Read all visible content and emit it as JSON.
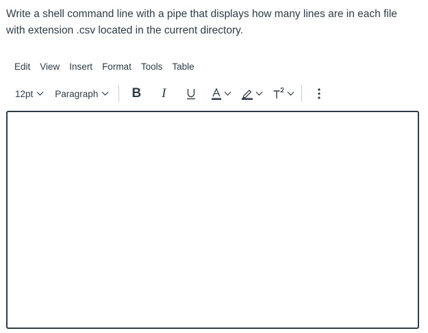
{
  "question": {
    "text": "Write a shell command line with a pipe that displays how many lines are in each file with extension .csv located in the current directory."
  },
  "menubar": {
    "items": [
      {
        "label": "Edit"
      },
      {
        "label": "View"
      },
      {
        "label": "Insert"
      },
      {
        "label": "Format"
      },
      {
        "label": "Tools"
      },
      {
        "label": "Table"
      }
    ]
  },
  "toolbar": {
    "font_size": "12pt",
    "block_format": "Paragraph",
    "bold_label": "B",
    "italic_label": "I",
    "icons": [
      "chevron-down-icon",
      "bold-icon",
      "italic-icon",
      "underline-icon",
      "text-color-icon",
      "highlight-icon",
      "superscript-icon",
      "more-vertical-icon"
    ],
    "accent_color": "#2d3b45"
  },
  "editor": {
    "value": ""
  }
}
